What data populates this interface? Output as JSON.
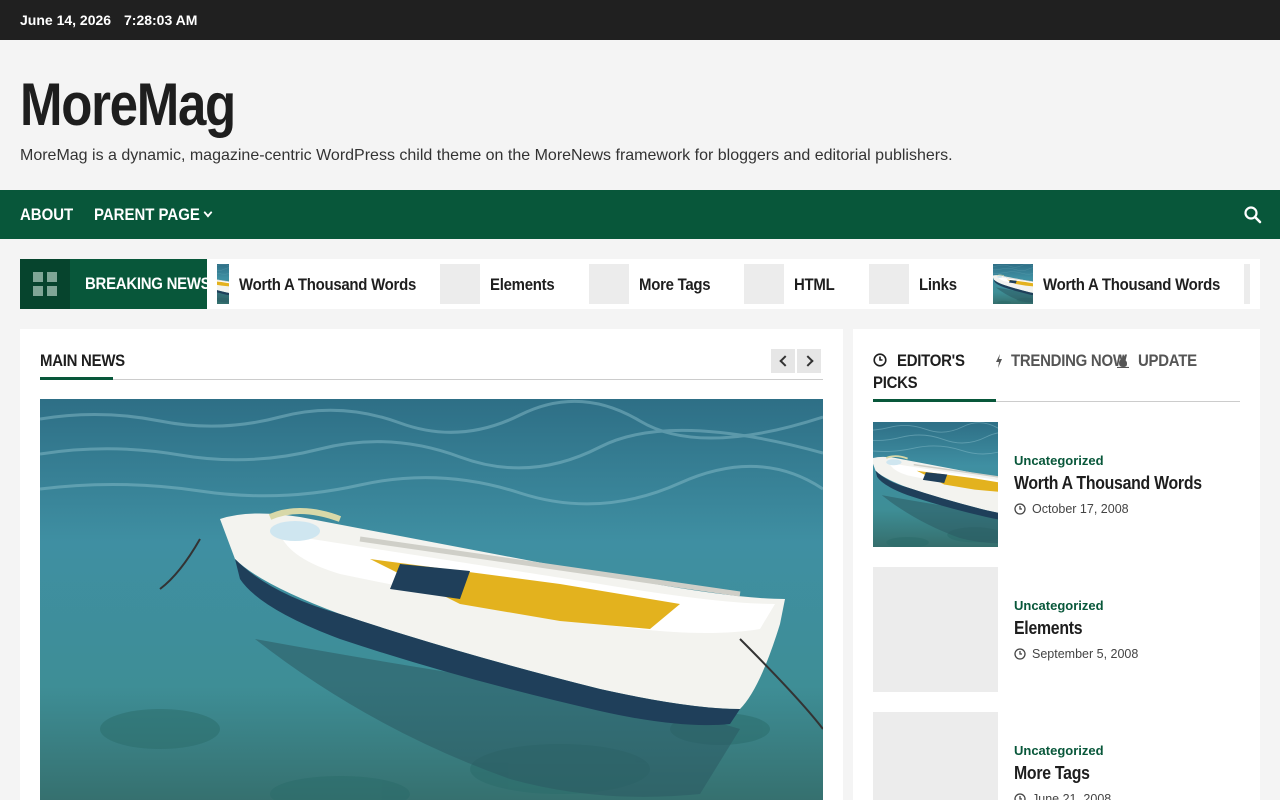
{
  "topbar": {
    "date": "June 14, 2026",
    "time": "7:28:03 AM"
  },
  "site": {
    "title": "MoreMag",
    "description": "MoreMag is a dynamic, magazine-centric WordPress child theme on the MoreNews framework for bloggers and editorial publishers."
  },
  "nav": {
    "about": "ABOUT",
    "parent": "PARENT PAGE",
    "search_icon": "search-icon"
  },
  "breaking": {
    "label": "BREAKING NEWS",
    "items": [
      "Worth A Thousand Words",
      "Elements",
      "More Tags",
      "HTML",
      "Links",
      "Worth A Thousand Words"
    ]
  },
  "main": {
    "title": "MAIN NEWS"
  },
  "sidebar": {
    "tabs": {
      "editor_line1": "EDITOR'S",
      "editor_line2": "PICKS",
      "trending": "TRENDING NOW",
      "update": "UPDATE"
    },
    "picks": [
      {
        "category": "Uncategorized",
        "title": "Worth A Thousand Words",
        "date": "October 17, 2008"
      },
      {
        "category": "Uncategorized",
        "title": "Elements",
        "date": "September 5, 2008"
      },
      {
        "category": "Uncategorized",
        "title": "More Tags",
        "date": "June 21, 2008"
      }
    ]
  },
  "colors": {
    "brand_green": "#08573a",
    "topbar": "#202020",
    "page_bg": "#f4f4f4"
  }
}
